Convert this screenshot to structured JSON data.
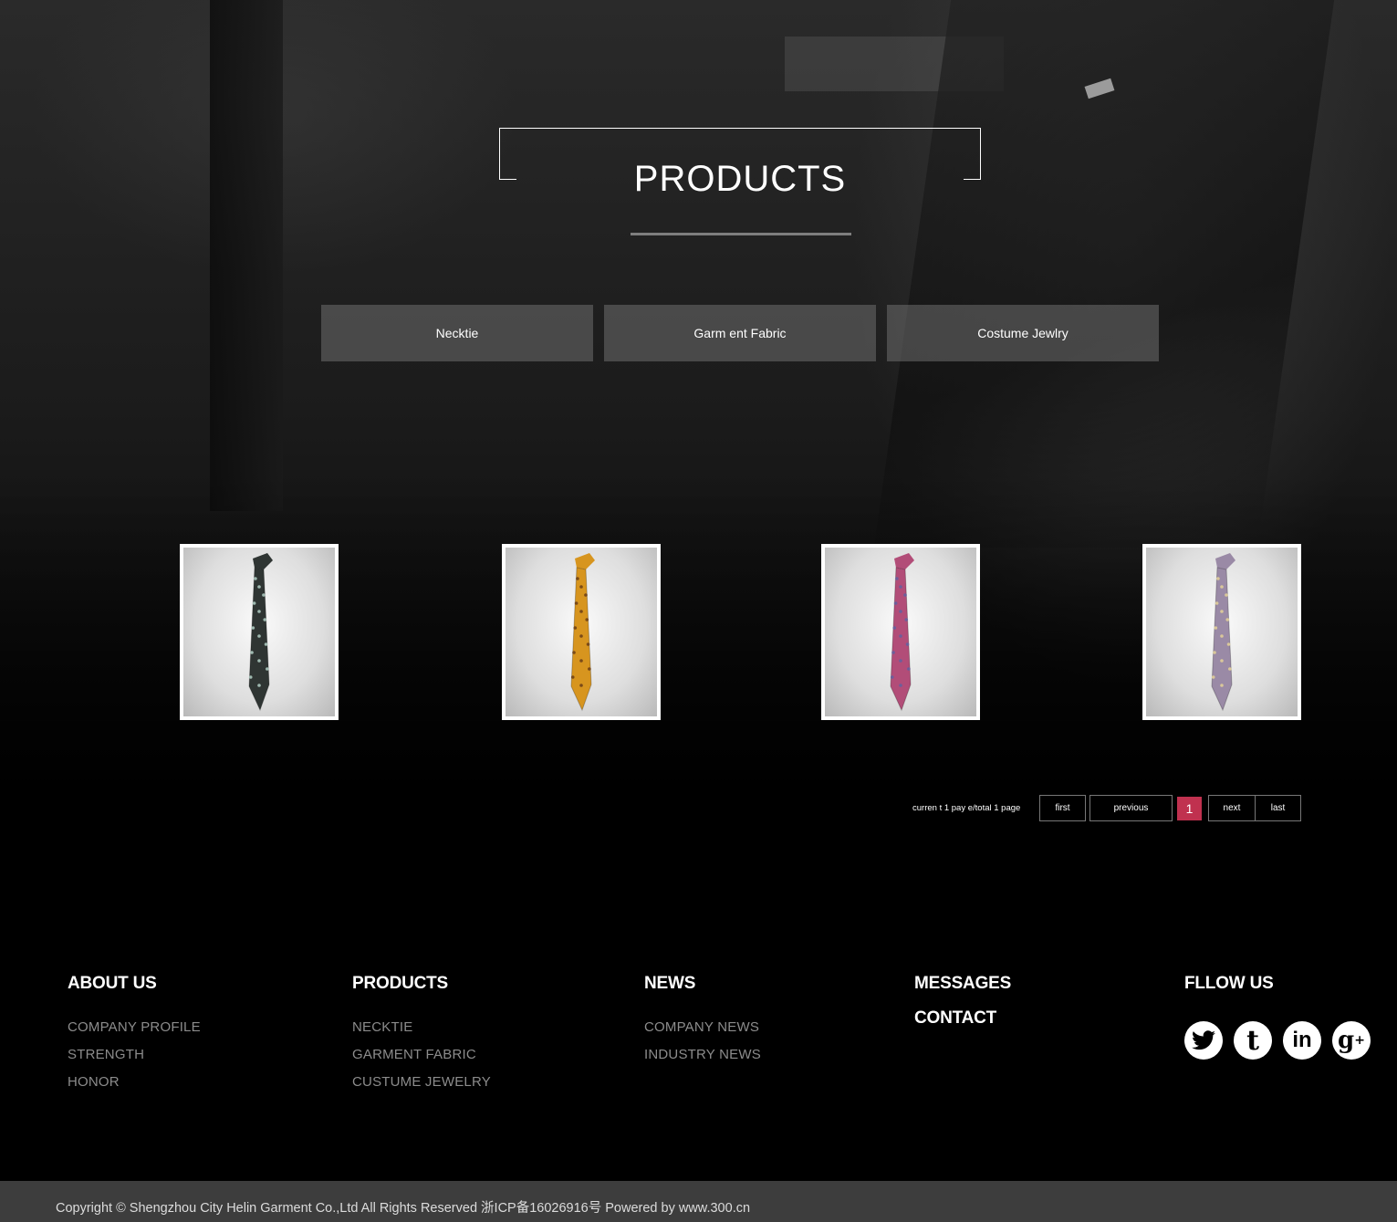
{
  "section": {
    "title": "PRODUCTS"
  },
  "categories": [
    {
      "label": "Necktie"
    },
    {
      "label": "Garm ent Fabric"
    },
    {
      "label": "Costume Jewlry"
    }
  ],
  "products": [
    {
      "name": "necktie-black-floral",
      "tie_color": "#2f3533",
      "dot_color": "#9fb9b0"
    },
    {
      "name": "necktie-orange-floral",
      "tie_color": "#d7951f",
      "dot_color": "#7a4a18"
    },
    {
      "name": "necktie-pink-stripe",
      "tie_color": "#b24d78",
      "dot_color": "#6d5e9a"
    },
    {
      "name": "necktie-lavender-stripe",
      "tie_color": "#9a8aa6",
      "dot_color": "#d9c79a"
    }
  ],
  "pagination": {
    "info": "curren t 1 pay e/total 1 page",
    "first": "first",
    "previous": "previous",
    "current": "1",
    "next": "next",
    "last": "last",
    "current_color": "#c0314f"
  },
  "footer": {
    "about": {
      "heading": "ABOUT US",
      "links": [
        "COMPANY PROFILE",
        "STRENGTH",
        "HONOR"
      ]
    },
    "products": {
      "heading": "PRODUCTS",
      "links": [
        "NECKTIE",
        "GARMENT FABRIC",
        "CUSTUME JEWELRY"
      ]
    },
    "news": {
      "heading": "NEWS",
      "links": [
        "COMPANY NEWS",
        "INDUSTRY NEWS"
      ]
    },
    "messages": {
      "heading": "MESSAGES"
    },
    "contact": {
      "heading": "CONTACT"
    },
    "follow": {
      "heading": "FLLOW US",
      "icons": [
        "twitter-icon",
        "tumblr-icon",
        "linkedin-icon",
        "google-plus-icon"
      ]
    },
    "copyright": "Copyright © Shengzhou City Helin Garment Co.,Ltd All Rights Reserved  浙ICP备16026916号  Powered by www.300.cn"
  }
}
